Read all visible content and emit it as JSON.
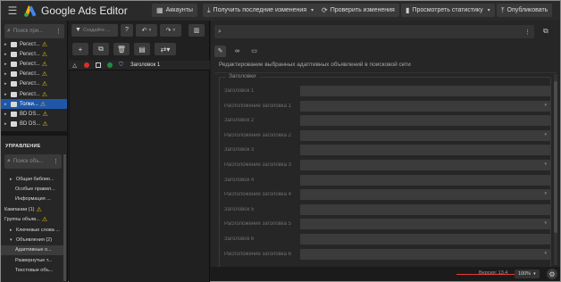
{
  "header": {
    "app_title": "Google Ads Editor",
    "accounts_label": "Аккаунты",
    "get_changes_label": "Получить последние изменения",
    "check_changes_label": "Проверить изменения",
    "view_stats_label": "Просмотреть статистику",
    "publish_label": "Опубликовать"
  },
  "accounts_panel": {
    "search_placeholder": "Поиск при...",
    "items": [
      {
        "label": "Регист...",
        "warning": true,
        "selected": false
      },
      {
        "label": "Регист...",
        "warning": true,
        "selected": false
      },
      {
        "label": "Регист...",
        "warning": true,
        "selected": false
      },
      {
        "label": "Регист...",
        "warning": true,
        "selected": false
      },
      {
        "label": "Регист...",
        "warning": true,
        "selected": false
      },
      {
        "label": "Регист...",
        "warning": true,
        "selected": false
      },
      {
        "label": "Толки...",
        "warning": true,
        "selected": true
      },
      {
        "label": "BD DS...",
        "warning": true,
        "selected": false
      },
      {
        "label": "BD DS...",
        "warning": true,
        "selected": false
      }
    ]
  },
  "management": {
    "title": "УПРАВЛЕНИЕ",
    "search_placeholder": "Поиск объ...",
    "items": [
      {
        "label": "Общая библио...",
        "indent": 1,
        "caret": "▸",
        "warning": false,
        "selected": false
      },
      {
        "label": "Особые правил...",
        "indent": 2,
        "caret": "",
        "warning": false,
        "selected": false
      },
      {
        "label": "Информация ...",
        "indent": 2,
        "caret": "",
        "warning": false,
        "selected": false
      },
      {
        "label": "Кампании (1)",
        "indent": 0,
        "caret": "",
        "warning": true,
        "selected": false
      },
      {
        "label": "Группы объяв...",
        "indent": 0,
        "caret": "",
        "warning": true,
        "selected": false
      },
      {
        "label": "Ключевые слова ...",
        "indent": 1,
        "caret": "▸",
        "warning": false,
        "selected": false
      },
      {
        "label": "Объявления (2)",
        "indent": 1,
        "caret": "▾",
        "warning": false,
        "selected": false
      },
      {
        "label": "Адаптивные о...",
        "indent": 2,
        "caret": "",
        "warning": false,
        "selected": true
      },
      {
        "label": "Развернутые т...",
        "indent": 2,
        "caret": "",
        "warning": false,
        "selected": false
      },
      {
        "label": "Текстовые объ...",
        "indent": 2,
        "caret": "",
        "warning": false,
        "selected": false
      }
    ]
  },
  "grid": {
    "filter_label": "Создайте ...",
    "header_title": "Заголовок 1",
    "status_colors": {
      "red": "#d93025",
      "green": "#1e8e3e",
      "blue": "#8ab4f8"
    }
  },
  "editor": {
    "heading": "Редактирование выбранных адаптивных объявлений в поисковой сети",
    "group_title": "Заголовки",
    "fields": [
      {
        "label": "Заголовок 1",
        "dropdown": false
      },
      {
        "label": "Расположение заголовка 1",
        "dropdown": true
      },
      {
        "label": "Заголовок 2",
        "dropdown": false
      },
      {
        "label": "Расположение заголовка 2",
        "dropdown": true
      },
      {
        "label": "Заголовок 3",
        "dropdown": false
      },
      {
        "label": "Расположение заголовка 3",
        "dropdown": true
      },
      {
        "label": "Заголовок 4",
        "dropdown": false
      },
      {
        "label": "Расположение заголовка 4",
        "dropdown": true
      },
      {
        "label": "Заголовок 5",
        "dropdown": false
      },
      {
        "label": "Расположение заголовка 5",
        "dropdown": true
      },
      {
        "label": "Заголовок 6",
        "dropdown": false
      },
      {
        "label": "Расположение заголовка 6",
        "dropdown": true
      }
    ]
  },
  "statusbar": {
    "version": "Версия: 13.4",
    "zoom": "100%"
  }
}
